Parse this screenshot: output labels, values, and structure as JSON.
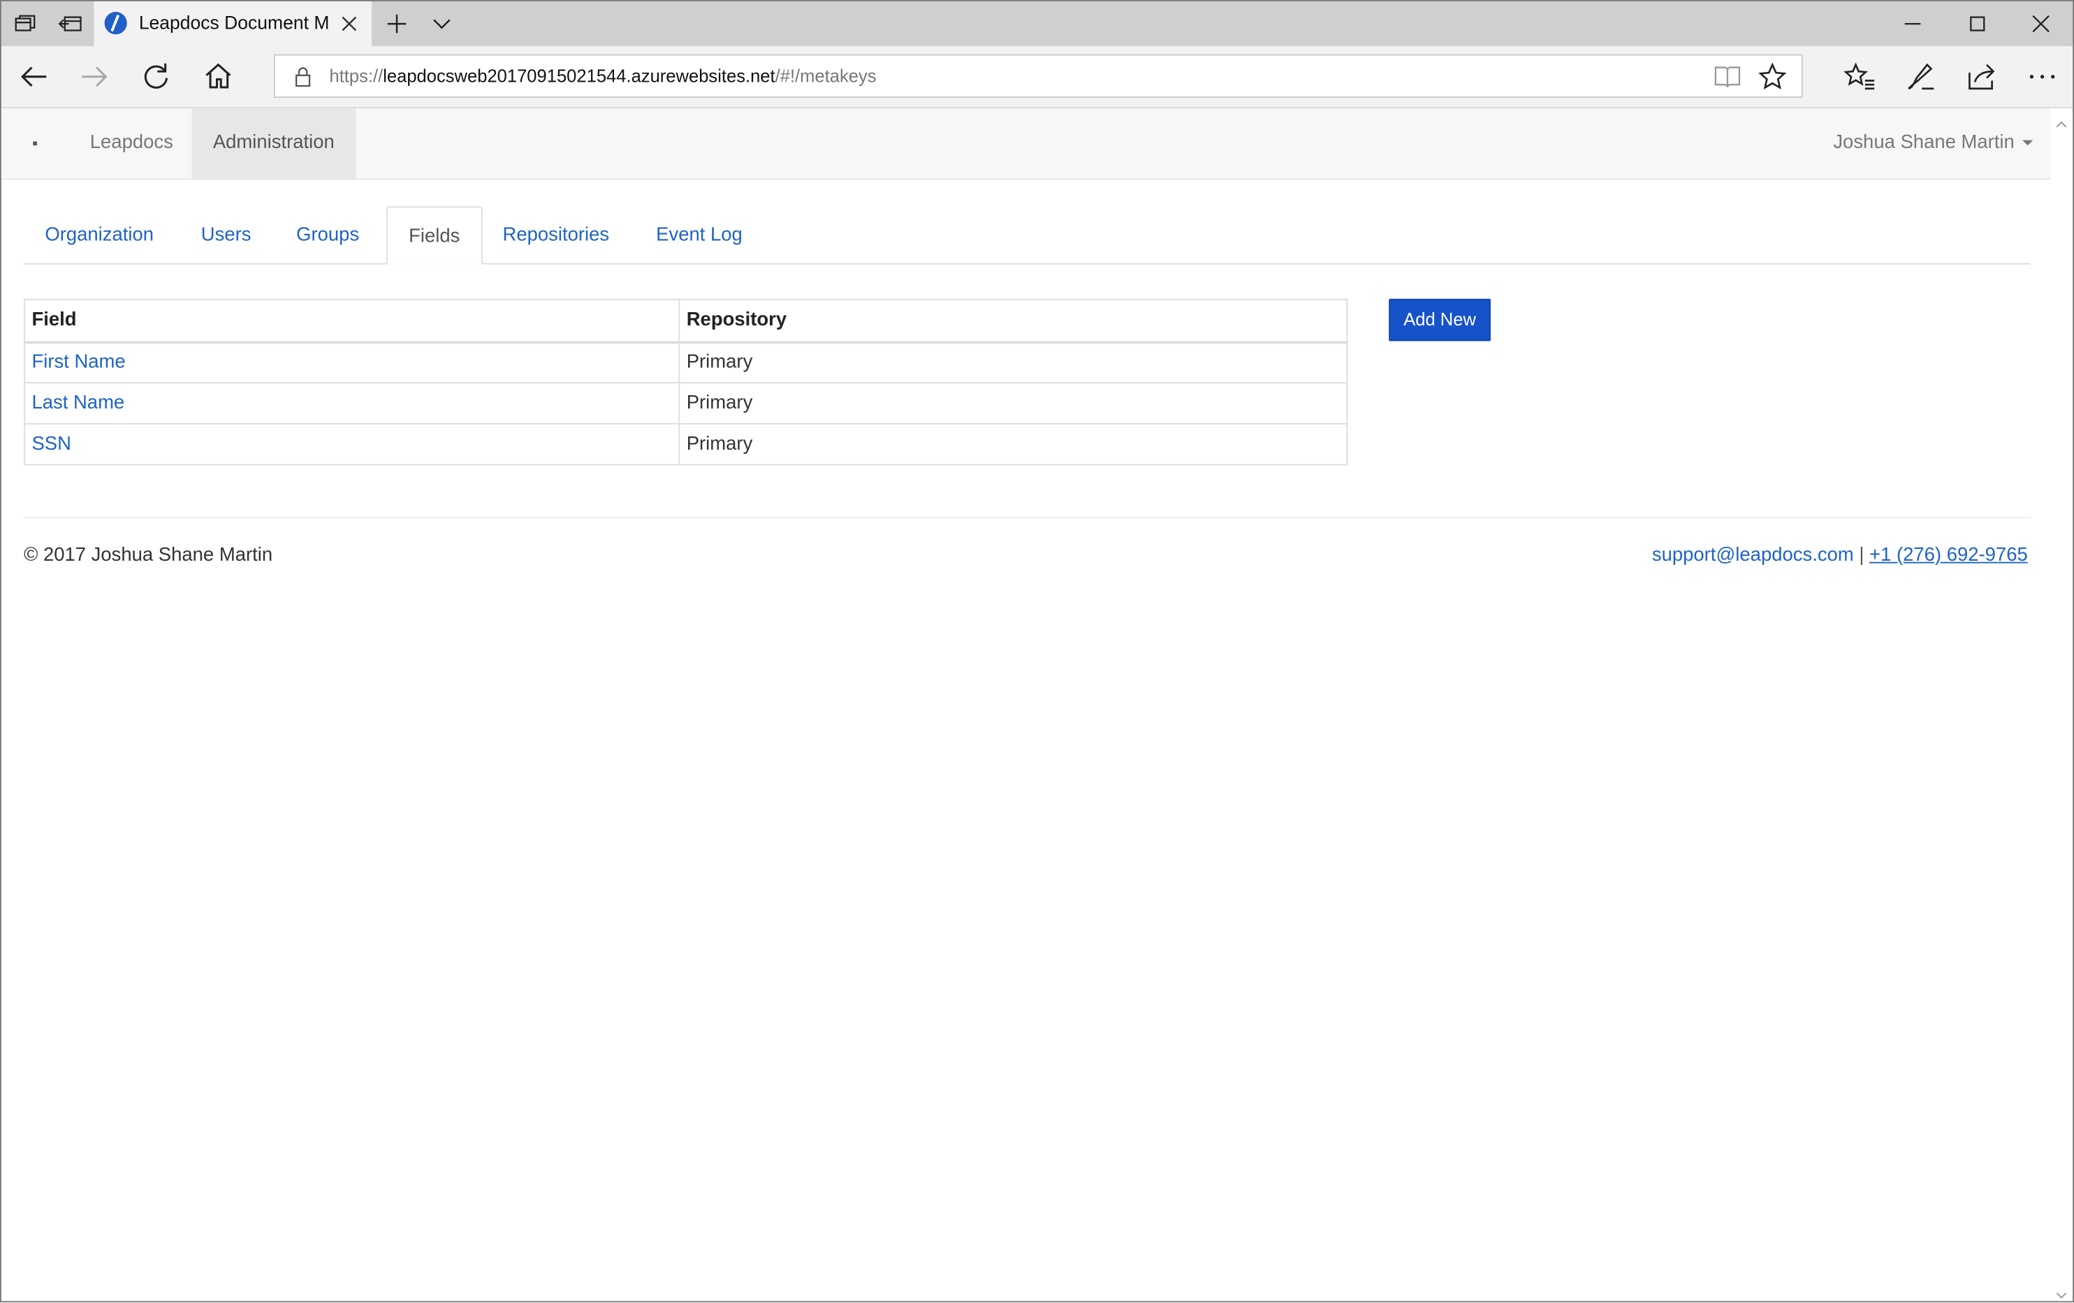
{
  "browser": {
    "tab_title": "Leapdocs Document Ma",
    "url_scheme": "https://",
    "url_host": "leapdocsweb20170915021544.azurewebsites.net",
    "url_path": "/#!/metakeys",
    "icons": [
      "tab-overview-icon",
      "tabs-aside-icon",
      "new-tab-icon",
      "tab-list-icon",
      "minimize-icon",
      "maximize-icon",
      "close-window-icon",
      "back-icon",
      "forward-icon",
      "refresh-icon",
      "home-icon",
      "lock-icon",
      "reading-view-icon",
      "favorite-star-icon",
      "favorites-icon",
      "notes-pen-icon",
      "share-icon",
      "more-icon"
    ]
  },
  "navbar": {
    "brand": "Leapdocs",
    "admin": "Administration",
    "user": "Joshua Shane Martin"
  },
  "admin_tabs": [
    {
      "label": "Organization"
    },
    {
      "label": "Users"
    },
    {
      "label": "Groups"
    },
    {
      "label": "Fields",
      "active": true
    },
    {
      "label": "Repositories"
    },
    {
      "label": "Event Log"
    }
  ],
  "table": {
    "headers": [
      "Field",
      "Repository"
    ],
    "rows": [
      {
        "field": "First Name",
        "repository": "Primary"
      },
      {
        "field": "Last Name",
        "repository": "Primary"
      },
      {
        "field": "SSN",
        "repository": "Primary"
      }
    ]
  },
  "actions": {
    "add_new": "Add New"
  },
  "footer": {
    "copyright": "© 2017 Joshua Shane Martin",
    "email": "support@leapdocs.com",
    "separator": "|",
    "phone": "+1 (276) 692-9765"
  },
  "colors": {
    "link": "#1f63c4",
    "primary_button": "#1653c9",
    "navbar_bg": "#f7f7f7"
  }
}
